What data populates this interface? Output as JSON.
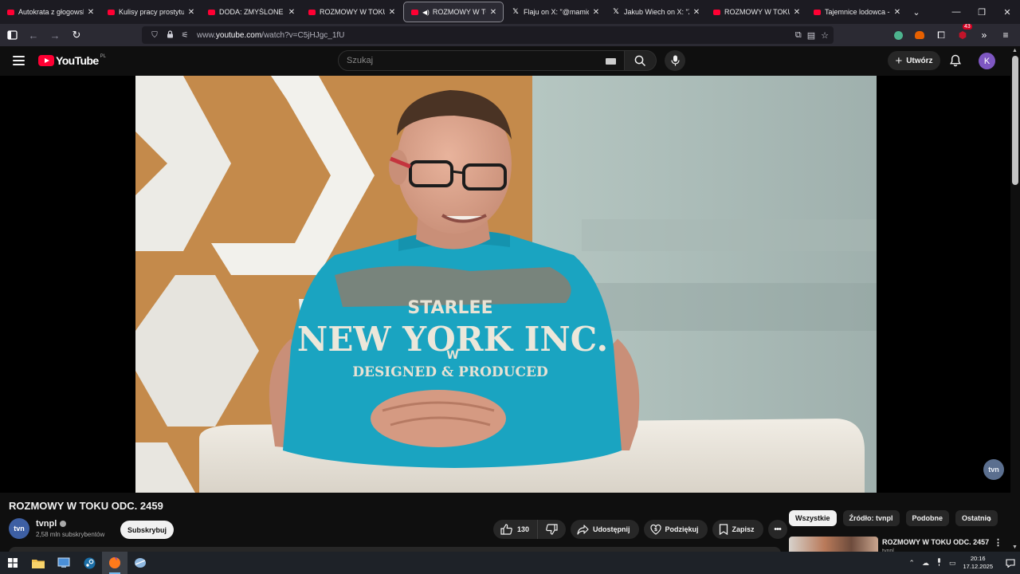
{
  "tabs": [
    {
      "title": "Autokrata z głogowskiej",
      "icon": "youtube-favicon",
      "active": false
    },
    {
      "title": "Kulisy pracy prostytutki.",
      "icon": "youtube-favicon",
      "active": false
    },
    {
      "title": "DODA: ZMYŚLONE ŻYCIE",
      "icon": "youtube-favicon",
      "active": false
    },
    {
      "title": "ROZMOWY W TOKU ODC",
      "icon": "youtube-favicon",
      "active": false
    },
    {
      "title": "ROZMOWY W TOKU",
      "icon": "youtube-favicon",
      "active": true
    },
    {
      "title": "Flaju on X: \"@mamiczi @",
      "icon": "x-favicon",
      "active": false
    },
    {
      "title": "Jakub Wiech on X: \"Zrob",
      "icon": "x-favicon",
      "active": false
    },
    {
      "title": "ROZMOWY W TOKU ODC",
      "icon": "youtube-favicon",
      "active": false
    },
    {
      "title": "Tajemnice lodowca - You",
      "icon": "youtube-favicon",
      "active": false
    }
  ],
  "browser": {
    "url_prefix": "www.",
    "url_domain": "youtube.com",
    "url_path": "/watch?v=C5jHJgc_1fU",
    "extension_badge": "43"
  },
  "youtube": {
    "logo_text": "YouTube",
    "country_code": "PL",
    "search_placeholder": "Szukaj",
    "create_label": "Utwórz",
    "account_initial": "K"
  },
  "video": {
    "title": "ROZMOWY W TOKU ODC. 2459",
    "channel_name": "tvnpl",
    "channel_avatar_text": "tvn",
    "subscribers": "2,58 mln subskrybentów",
    "subscribe_label": "Subskrybuj",
    "like_count": "130",
    "share_label": "Udostępnij",
    "thanks_label": "Podziękuj",
    "save_label": "Zapisz",
    "watermark_text": "tvn"
  },
  "shirt": {
    "line1": "STARLEE",
    "line2": "NEW YORK INC.",
    "line3": "W",
    "line4": "DESIGNED & PRODUCED"
  },
  "sidebar": {
    "chips": [
      "Wszystkie",
      "Źródło: tvnpl",
      "Podobne",
      "Ostatnio"
    ],
    "active_chip": 0,
    "recommended": [
      {
        "title": "ROZMOWY W TOKU ODC. 2457",
        "channel": "tvnpl"
      }
    ]
  },
  "taskbar": {
    "apps": [
      "windows-start-icon",
      "file-explorer-icon",
      "control-panel-icon",
      "steam-icon",
      "firefox-icon",
      "app-icon"
    ],
    "time": "20:16",
    "date": "17.12.2025"
  }
}
